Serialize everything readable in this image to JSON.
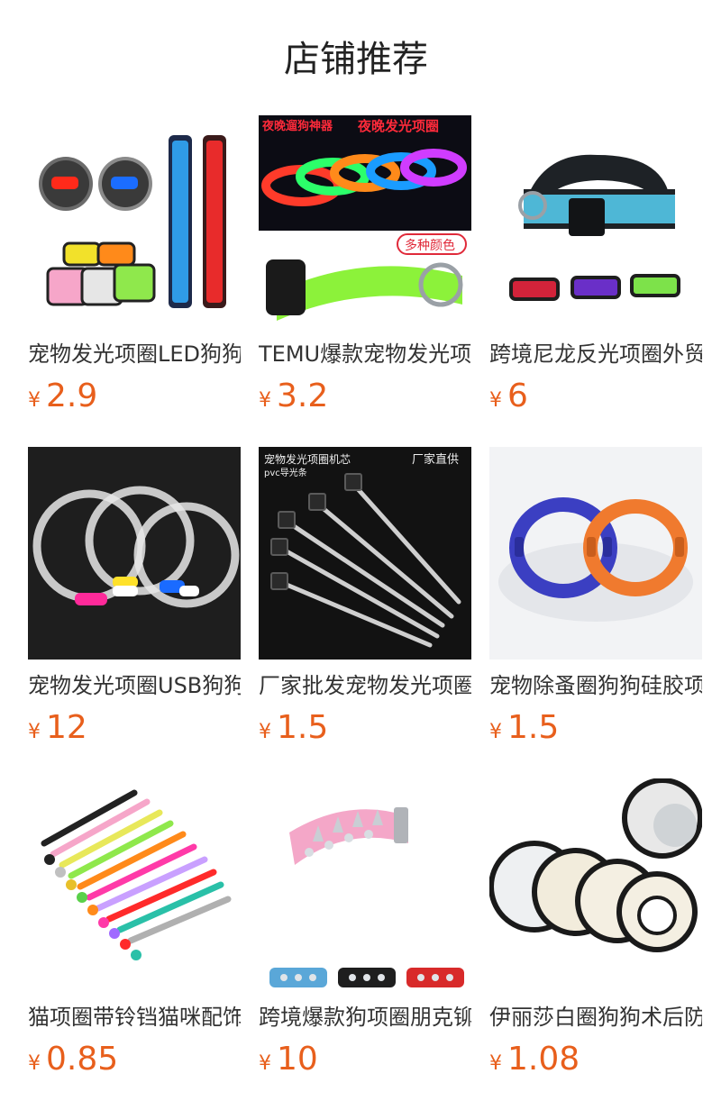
{
  "page": {
    "title": "店铺推荐"
  },
  "colors": {
    "price": "#e85f1c",
    "text": "#333333",
    "background": "#ffffff"
  },
  "products": [
    {
      "name": "宠物发光项圈LED狗狗",
      "currency": "¥",
      "price": "2.9",
      "image": "led-armbands-photo"
    },
    {
      "name": "TEMU爆款宠物发光项圈",
      "currency": "¥",
      "price": "3.2",
      "image": "glowing-collars-photo",
      "overlay": {
        "top_left": "夜晚遛狗神器",
        "top_right": "夜晚发光项圈",
        "badge": "多种颜色"
      }
    },
    {
      "name": "跨境尼龙反光项圈外贸",
      "currency": "¥",
      "price": "6",
      "image": "nylon-reflective-collars-photo"
    },
    {
      "name": "宠物发光项圈USB狗狗",
      "currency": "¥",
      "price": "12",
      "image": "usb-tube-collars-photo"
    },
    {
      "name": "厂家批发宠物发光项圈",
      "currency": "¥",
      "price": "1.5",
      "image": "light-core-sticks-photo",
      "overlay": {
        "top_left": "宠物发光项圈机芯",
        "sub_left": "pvc导光条",
        "top_right": "厂家直供"
      }
    },
    {
      "name": "宠物除蚤圈狗狗硅胶项圈",
      "currency": "¥",
      "price": "1.5",
      "image": "silicone-flea-collars-photo"
    },
    {
      "name": "猫项圈带铃铛猫咪配饰",
      "currency": "¥",
      "price": "0.85",
      "image": "cat-bell-collars-photo"
    },
    {
      "name": "跨境爆款狗项圈朋克铆钉",
      "currency": "¥",
      "price": "10",
      "image": "spiked-punk-collars-photo"
    },
    {
      "name": "伊丽莎白圈狗狗术后防咬",
      "currency": "¥",
      "price": "1.08",
      "image": "elizabethan-cones-photo"
    }
  ]
}
